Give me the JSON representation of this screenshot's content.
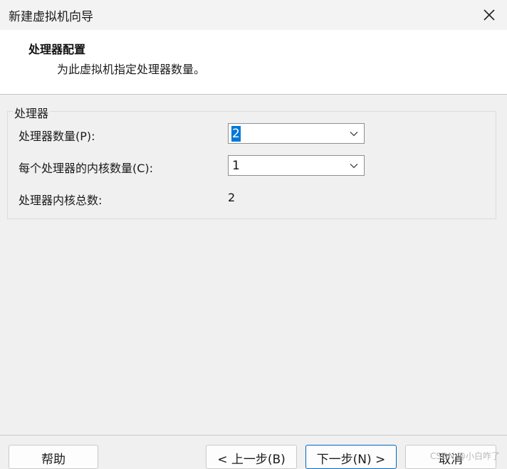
{
  "window": {
    "title": "新建虚拟机向导",
    "close_icon": "close-icon"
  },
  "header": {
    "title": "处理器配置",
    "subtitle": "为此虚拟机指定处理器数量。"
  },
  "processor_group": {
    "legend": "处理器",
    "processor_count_label": "处理器数量(P):",
    "processor_count_value": "2",
    "cores_per_processor_label": "每个处理器的内核数量(C):",
    "cores_per_processor_value": "1",
    "total_cores_label": "处理器内核总数:",
    "total_cores_value": "2"
  },
  "footer": {
    "help_label": "帮助",
    "back_label": "< 上一步(B)",
    "next_label": "下一步(N) >",
    "cancel_label": "取消"
  },
  "watermark": "CSDN @小白咋了",
  "colors": {
    "selection": "#0078d7",
    "primary_border": "#0067c0"
  }
}
